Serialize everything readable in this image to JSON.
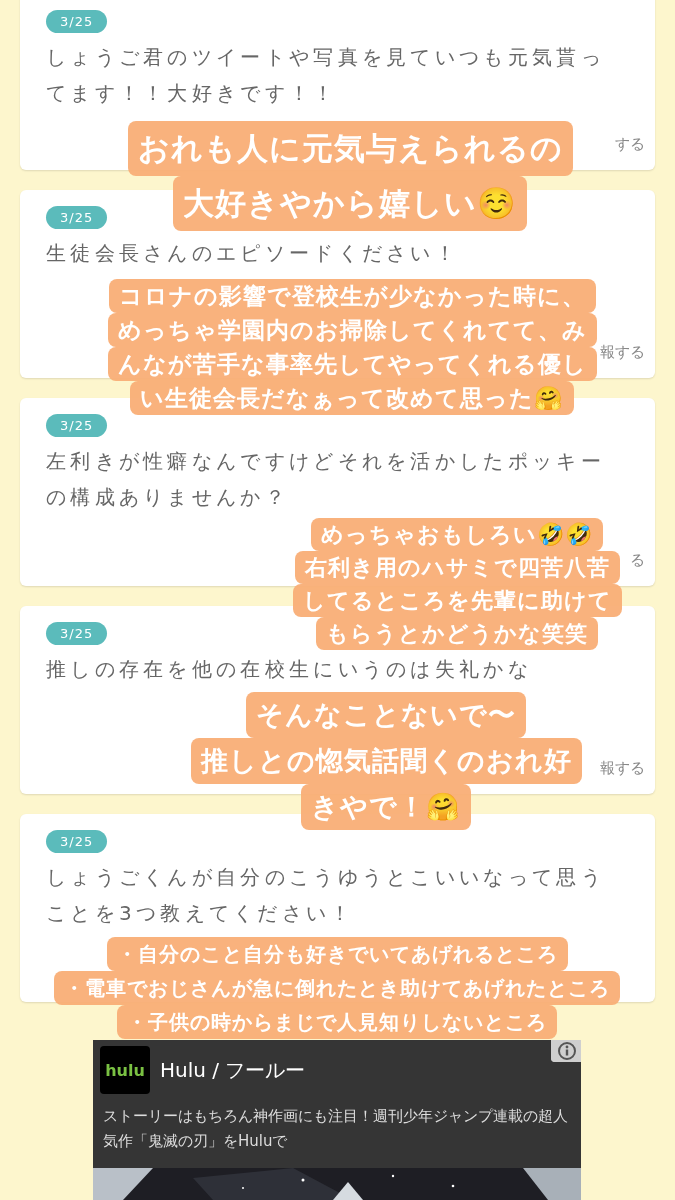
{
  "questions": [
    {
      "date": "3/25",
      "text": "しょうご君のツイートや写真を見ていつも元気貰ってます！！大好きです！！",
      "actions": [
        {
          "kind": "report",
          "label": "する"
        }
      ]
    },
    {
      "date": "3/25",
      "text": "生徒会長さんのエピソードください！",
      "actions": [
        {
          "kind": "report",
          "label": "報する"
        }
      ]
    },
    {
      "date": "3/25",
      "text": "左利きが性癖なんですけどそれを活かしたポッキーの構成ありませんか？",
      "actions": [
        {
          "kind": "report",
          "label": "る"
        }
      ]
    },
    {
      "date": "3/25",
      "text": "推しの存在を他の在校生にいうのは失礼かな",
      "actions": [
        {
          "kind": "report",
          "label": "報する"
        }
      ]
    },
    {
      "date": "3/25",
      "text": "しょうごくんが自分のこうゆうとこいいなって思うことを3つ教えてください！"
    }
  ],
  "captions": [
    {
      "lines": [
        "おれも人に元気与えられるの",
        "大好きやから嬉しい☺️"
      ]
    },
    {
      "lines": [
        "コロナの影響で登校生が少なかった時に、",
        "めっちゃ学園内のお掃除してくれてて、み",
        "んなが苦手な事率先してやってくれる優し",
        "い生徒会長だなぁって改めて思った🤗"
      ]
    },
    {
      "lines": [
        "めっちゃおもしろい🤣🤣",
        "右利き用のハサミで四苦八苦",
        "してるところを先輩に助けて",
        "もらうとかどうかな笑笑"
      ]
    },
    {
      "lines": [
        "そんなことないで〜",
        "推しとの惚気話聞くのおれ好",
        "きやで！🤗"
      ]
    },
    {
      "lines": [
        "・自分のこと自分も好きでいてあげれるところ",
        "・電車でおじさんが急に倒れたとき助けてあげれたところ",
        "・子供の時からまじで人見知りしないところ"
      ]
    }
  ],
  "ad": {
    "logo_text": "hulu",
    "title": "Hulu / フールー",
    "description": "ストーリーはもちろん神作画にも注目！週刊少年ジャンプ連載の超人気作「鬼滅の刃」をHuluで"
  }
}
